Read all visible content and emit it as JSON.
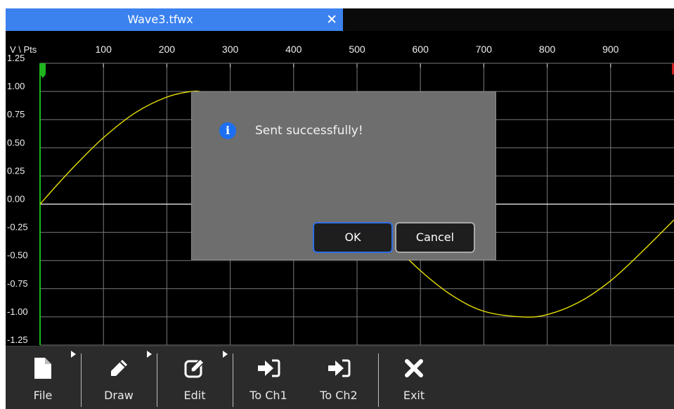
{
  "tab": {
    "title": "Wave3.tfwx",
    "close_glyph": "✕"
  },
  "chart_data": {
    "type": "line",
    "corner_label": "V \\ Pts",
    "x_ticks": [
      "100",
      "200",
      "300",
      "400",
      "500",
      "600",
      "700",
      "800",
      "900"
    ],
    "x_tick_values": [
      100,
      200,
      300,
      400,
      500,
      600,
      700,
      800,
      900
    ],
    "y_ticks": [
      "1.25",
      "1.00",
      "0.75",
      "0.50",
      "0.25",
      "0.00",
      "-0.25",
      "-0.50",
      "-0.75",
      "-1.00",
      "-1.25"
    ],
    "y_tick_values": [
      1.25,
      1.0,
      0.75,
      0.5,
      0.25,
      0.0,
      -0.25,
      -0.5,
      -0.75,
      -1.0,
      -1.25
    ],
    "xlim": [
      0,
      1000
    ],
    "ylim": [
      -1.25,
      1.25
    ],
    "grid": true,
    "series": [
      {
        "color": "#e8e000",
        "x": [
          0,
          30,
          60,
          100,
          150,
          200,
          240,
          260,
          300,
          350,
          400,
          450,
          500,
          550,
          600,
          650,
          700,
          760,
          800,
          850,
          900,
          950,
          1000
        ],
        "y": [
          0.0,
          0.19,
          0.37,
          0.59,
          0.81,
          0.95,
          1.0,
          0.99,
          0.95,
          0.81,
          0.59,
          0.31,
          0.0,
          -0.31,
          -0.59,
          -0.81,
          -0.95,
          -1.0,
          -0.98,
          -0.87,
          -0.68,
          -0.42,
          -0.14
        ]
      }
    ],
    "colors": {
      "background": "#000000",
      "grid": "#7a7a7a",
      "axis": "#d9d9d9",
      "zero_line": "#d9d9d9",
      "y_axis_marker": "#1fb51f",
      "right_marker": "#c81e1e"
    }
  },
  "dialog": {
    "icon": "info-icon",
    "icon_glyph": "i",
    "message": "Sent successfully!",
    "ok_label": "OK",
    "cancel_label": "Cancel"
  },
  "toolbar": {
    "items": [
      {
        "label": "File",
        "icon": "file-icon"
      },
      {
        "label": "Draw",
        "icon": "pencil-icon"
      },
      {
        "label": "Edit",
        "icon": "edit-icon"
      },
      {
        "label": "To Ch1",
        "icon": "send-to-channel-icon"
      },
      {
        "label": "To Ch2",
        "icon": "send-to-channel-icon"
      },
      {
        "label": "Exit",
        "icon": "close-icon"
      }
    ]
  }
}
